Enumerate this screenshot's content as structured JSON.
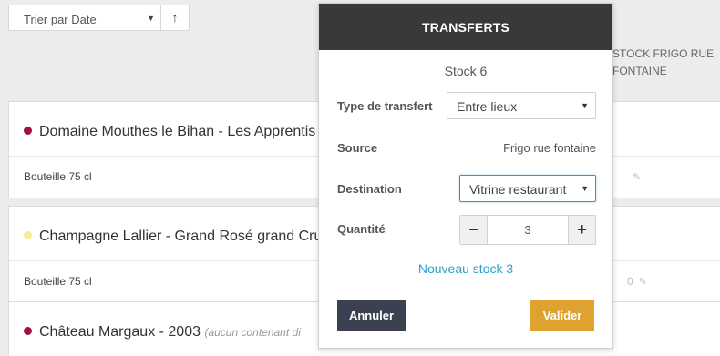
{
  "toolbar": {
    "sort_value": "Trier par Date",
    "sort_direction_glyph": "↑"
  },
  "column_header": "STOCK FRIGO RUE FONTAINE",
  "products": [
    {
      "name": "Domaine Mouthes le Bihan - Les Apprentis",
      "note": "",
      "dot_color": "#a0123e",
      "format": "Bouteille 75 cl",
      "stock": ""
    },
    {
      "name": "Champagne Lallier - Grand Rosé grand Cru",
      "note": "",
      "dot_color": "#f5ec96",
      "format": "Bouteille 75 cl",
      "stock": "0"
    },
    {
      "name": "Château Margaux - 2003",
      "note": "(aucun contenant di",
      "dot_color": "#a0123e",
      "format": "",
      "stock": ""
    }
  ],
  "modal": {
    "title": "TRANSFERTS",
    "subtitle": "Stock 6",
    "type_label": "Type de transfert",
    "type_value": "Entre lieux",
    "source_label": "Source",
    "source_value": "Frigo rue fontaine",
    "destination_label": "Destination",
    "destination_value": "Vitrine restaurant",
    "quantity_label": "Quantité",
    "quantity_value": "3",
    "minus_glyph": "−",
    "plus_glyph": "+",
    "new_stock": "Nouveau stock 3",
    "cancel_label": "Annuler",
    "confirm_label": "Valider"
  },
  "colors": {
    "modal_header": "#3b3838",
    "cancel_button": "#3b4150",
    "confirm_button": "#dda22f",
    "link": "#2aa2c8"
  }
}
